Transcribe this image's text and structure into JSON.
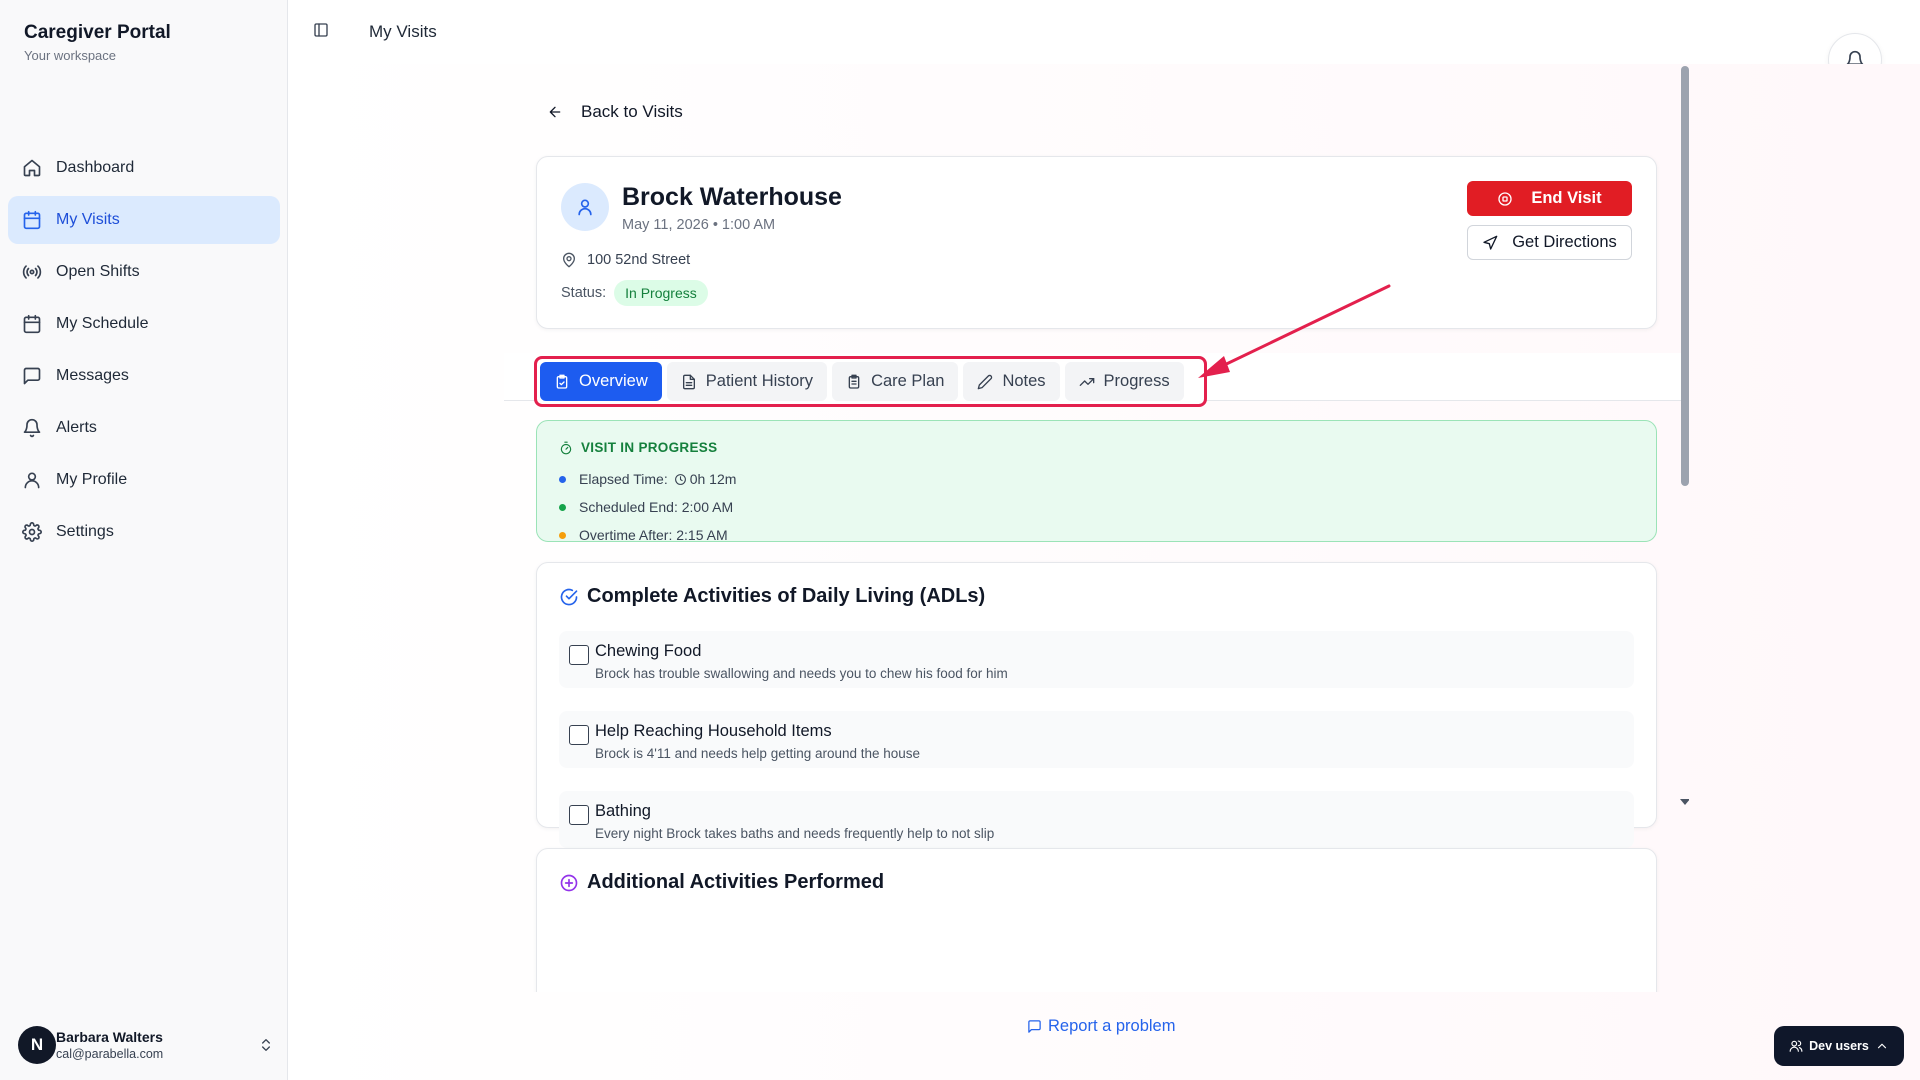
{
  "sidebar": {
    "brand_title": "Caregiver Portal",
    "brand_subtitle": "Your workspace",
    "items": [
      {
        "label": "Dashboard",
        "icon": "home-icon"
      },
      {
        "label": "My Visits",
        "icon": "calendar-icon",
        "active": true
      },
      {
        "label": "Open Shifts",
        "icon": "broadcast-icon"
      },
      {
        "label": "My Schedule",
        "icon": "calendar-icon"
      },
      {
        "label": "Messages",
        "icon": "message-icon"
      },
      {
        "label": "Alerts",
        "icon": "bell-icon"
      },
      {
        "label": "My Profile",
        "icon": "user-icon"
      },
      {
        "label": "Settings",
        "icon": "gear-icon"
      }
    ],
    "user": {
      "initial": "N",
      "name": "Barbara Walters",
      "email": "cal@parabella.com"
    }
  },
  "header": {
    "breadcrumb": "My Visits"
  },
  "back_link": "Back to Visits",
  "visit": {
    "patient_name": "Brock Waterhouse",
    "datetime": "May 11, 2026 • 1:00 AM",
    "address": "100 52nd Street",
    "status_label": "Status:",
    "status": "In Progress",
    "end_visit_label": "End Visit",
    "directions_label": "Get Directions"
  },
  "tabs": [
    {
      "label": "Overview",
      "icon": "clipboard-check-icon",
      "active": true
    },
    {
      "label": "Patient History",
      "icon": "file-text-icon"
    },
    {
      "label": "Care Plan",
      "icon": "clipboard-icon"
    },
    {
      "label": "Notes",
      "icon": "pencil-icon"
    },
    {
      "label": "Progress",
      "icon": "trending-up-icon"
    }
  ],
  "progress": {
    "title": "VISIT IN PROGRESS",
    "elapsed_label": "Elapsed Time:",
    "elapsed_value": "0h 12m",
    "scheduled_end": "Scheduled End: 2:00 AM",
    "overtime": "Overtime After: 2:15 AM",
    "colors": {
      "elapsed": "#2563eb",
      "scheduled": "#16a34a",
      "overtime": "#f59e0b"
    }
  },
  "adl": {
    "title": "Complete Activities of Daily Living (ADLs)",
    "items": [
      {
        "name": "Chewing Food",
        "description": "Brock has trouble swallowing and needs you to chew his food for him"
      },
      {
        "name": "Help Reaching Household Items",
        "description": "Brock is 4'11 and needs help getting around the house"
      },
      {
        "name": "Bathing",
        "description": "Every night Brock takes baths and needs frequently help to not slip"
      }
    ]
  },
  "next_section": {
    "title": "Additional Activities Performed"
  },
  "footer": {
    "report_label": "Report a problem",
    "dev_users_label": "Dev users"
  },
  "colors": {
    "accent": "#1d5cf0",
    "danger": "#e11d24",
    "highlight": "#e3204d",
    "success_bg": "#e9faf0"
  }
}
